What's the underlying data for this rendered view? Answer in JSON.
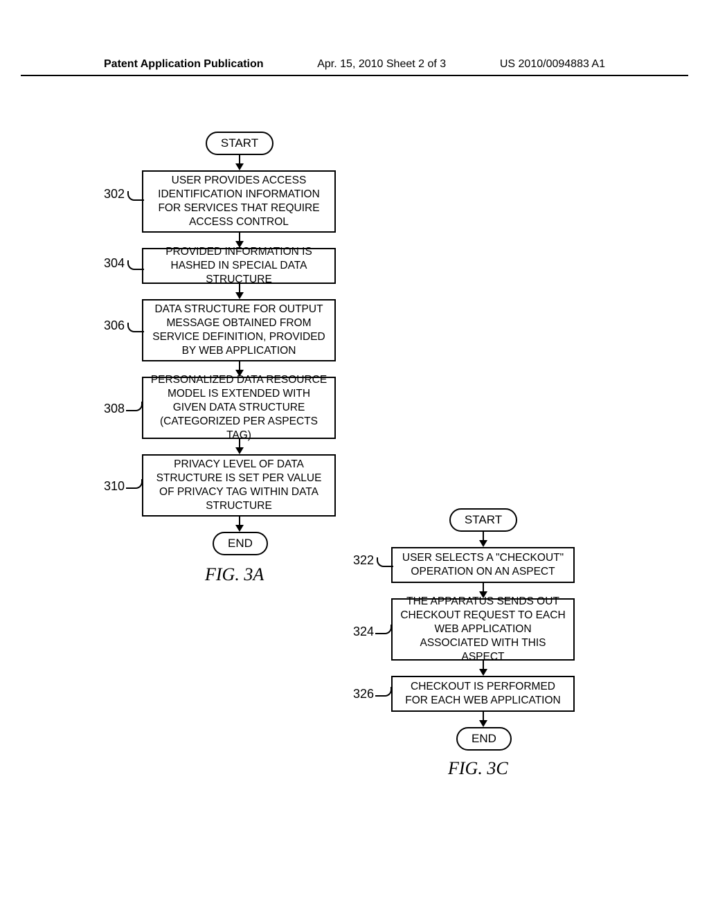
{
  "header": {
    "left": "Patent Application Publication",
    "mid": "Apr. 15, 2010  Sheet 2 of 3",
    "right": "US 2010/0094883 A1"
  },
  "fig3a": {
    "caption": "FIG. 3A",
    "start": "START",
    "end": "END",
    "steps": {
      "302": {
        "ref": "302",
        "text": "USER PROVIDES ACCESS IDENTIFICATION INFORMATION FOR SERVICES THAT REQUIRE ACCESS CONTROL"
      },
      "304": {
        "ref": "304",
        "text": "PROVIDED INFORMATION IS HASHED IN SPECIAL DATA STRUCTURE"
      },
      "306": {
        "ref": "306",
        "text": "DATA STRUCTURE FOR OUTPUT MESSAGE OBTAINED FROM SERVICE DEFINITION, PROVIDED BY WEB APPLICATION"
      },
      "308": {
        "ref": "308",
        "text": "PERSONALIZED DATA RESOURCE MODEL IS EXTENDED WITH GIVEN DATA STRUCTURE (CATEGORIZED PER ASPECTS TAG)"
      },
      "310": {
        "ref": "310",
        "text": "PRIVACY LEVEL OF DATA STRUCTURE IS SET PER VALUE OF PRIVACY TAG WITHIN DATA STRUCTURE"
      }
    }
  },
  "fig3c": {
    "caption": "FIG. 3C",
    "start": "START",
    "end": "END",
    "steps": {
      "322": {
        "ref": "322",
        "text": "USER SELECTS A \"CHECKOUT\" OPERATION ON AN ASPECT"
      },
      "324": {
        "ref": "324",
        "text": "THE APPARATUS SENDS OUT CHECKOUT REQUEST TO EACH WEB APPLICATION ASSOCIATED WITH THIS ASPECT"
      },
      "326": {
        "ref": "326",
        "text": "CHECKOUT IS PERFORMED FOR EACH WEB APPLICATION"
      }
    }
  }
}
